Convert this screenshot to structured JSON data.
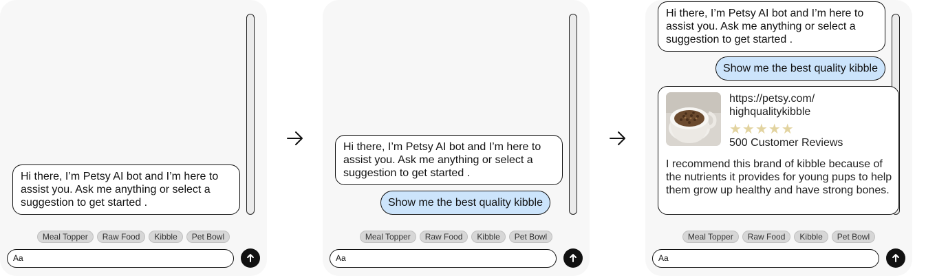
{
  "bot_greeting": "Hi there, I’m Petsy AI bot and I’m here to assist you. Ask me anything or select a suggestion to get started .",
  "user_message": "Show me the best quality kibble",
  "suggestions": [
    "Meal Topper",
    "Raw Food",
    "Kibble",
    "Pet Bowl"
  ],
  "input_placeholder": "Aa",
  "product": {
    "url": "https://petsy.com/ highqualitykibble",
    "rating": 5,
    "stars": "★★★★★",
    "reviews": "500 Customer Reviews",
    "description": "I recommend this brand of kibble because of the nutrients it provides for young pups to help them grow up healthy and have strong bones."
  },
  "colors": {
    "panel_bg": "#f7f7f7",
    "user_bubble": "#cce4fb",
    "chip_bg": "#d7d7d7",
    "star": "#e2d39f",
    "send_button": "#111111"
  },
  "icons": {
    "send": "arrow-up-icon",
    "flow_arrow": "arrow-right-icon"
  }
}
